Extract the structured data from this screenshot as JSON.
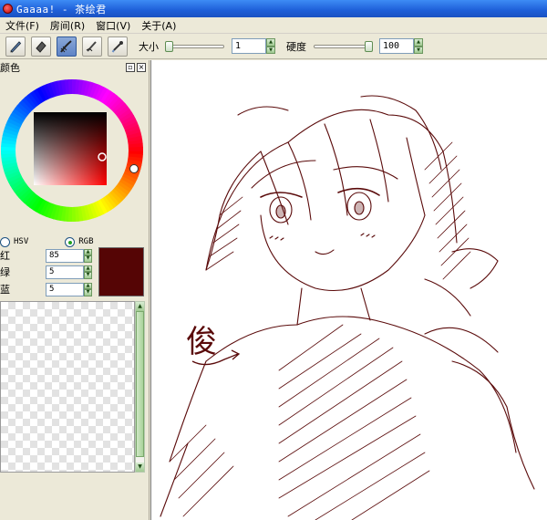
{
  "window": {
    "title": "Gaaaa! - 茶绘君"
  },
  "menu": [
    {
      "label": "文件(F)"
    },
    {
      "label": "房间(R)"
    },
    {
      "label": "窗口(V)"
    },
    {
      "label": "关于(A)"
    }
  ],
  "toolbar": {
    "tools": [
      "pen-icon",
      "eraser-icon",
      "brush-icon",
      "blur-icon",
      "eyedropper-icon"
    ],
    "active_tool": "brush-icon",
    "size_label": "大小",
    "size_value": "1",
    "size_level": 0.0,
    "hardness_label": "硬度",
    "hardness_value": "100",
    "hardness_level": 1.0
  },
  "color_panel": {
    "title": "颜色",
    "mode_hsv": "HSV",
    "mode_rgb": "RGB",
    "selected_mode": "RGB",
    "red_label": "红",
    "red_value": "85",
    "green_label": "绿",
    "green_value": "5",
    "blue_label": "蓝",
    "blue_value": "5",
    "current_color": "#550505",
    "hue_color": "#ff0000"
  },
  "canvas": {
    "handwriting": "俊",
    "stroke_color": "#5a0a0a"
  }
}
